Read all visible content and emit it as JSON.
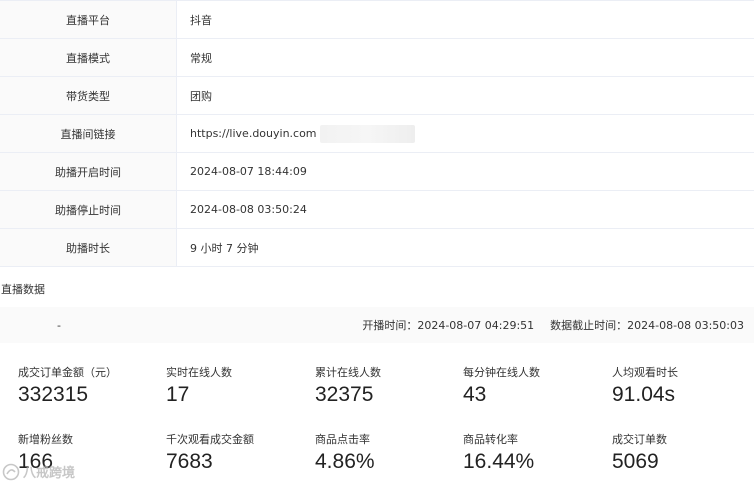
{
  "info": {
    "rows": [
      {
        "label": "直播平台",
        "value": "抖音"
      },
      {
        "label": "直播模式",
        "value": "常规"
      },
      {
        "label": "带货类型",
        "value": "团购"
      },
      {
        "label": "直播间链接",
        "value": "https://live.douyin.com"
      },
      {
        "label": "助播开启时间",
        "value": "2024-08-07 18:44:09"
      },
      {
        "label": "助播停止时间",
        "value": "2024-08-08 03:50:24"
      },
      {
        "label": "助播时长",
        "value": "9 小时 7 分钟"
      }
    ]
  },
  "stats": {
    "section_title": "直播数据",
    "header": {
      "dash": "-",
      "start_label": "开播时间：",
      "start_value": "2024-08-07 04:29:51",
      "cutoff_label": "数据截止时间：",
      "cutoff_value": "2024-08-08 03:50:03"
    },
    "metrics": [
      {
        "label": "成交订单金额（元）",
        "value": "332315"
      },
      {
        "label": "实时在线人数",
        "value": "17"
      },
      {
        "label": "累计在线人数",
        "value": "32375"
      },
      {
        "label": "每分钟在线人数",
        "value": "43"
      },
      {
        "label": "人均观看时长",
        "value": "91.04s"
      },
      {
        "label": "新增粉丝数",
        "value": "166"
      },
      {
        "label": "千次观看成交金额",
        "value": "7683"
      },
      {
        "label": "商品点击率",
        "value": "4.86%"
      },
      {
        "label": "商品转化率",
        "value": "16.44%"
      },
      {
        "label": "成交订单数",
        "value": "5069"
      }
    ]
  },
  "watermark": {
    "text": "八戒跨境",
    "icon": "watermark-logo-icon"
  }
}
